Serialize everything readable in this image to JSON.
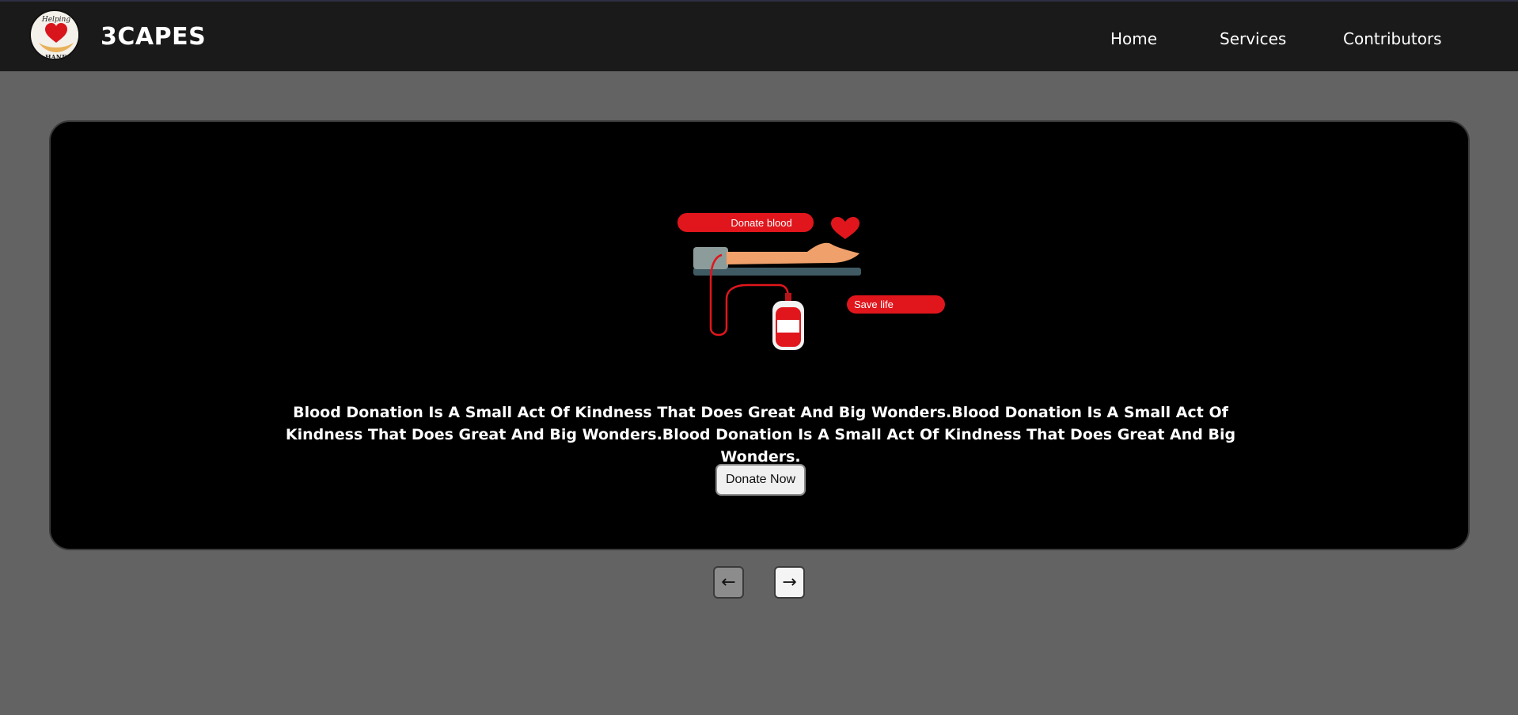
{
  "header": {
    "logo_text_top": "Helping",
    "logo_text_bottom": "HAND",
    "brand": "3CAPES",
    "nav": [
      {
        "label": "Home"
      },
      {
        "label": "Services"
      },
      {
        "label": "Contributors"
      }
    ]
  },
  "slide": {
    "illustration": {
      "donate_label": "Donate blood",
      "save_label": "Save life"
    },
    "message": "Blood Donation Is A Small Act Of Kindness That Does Great And Big Wonders.Blood Donation Is A Small Act Of Kindness That Does Great And Big Wonders.Blood Donation Is A Small Act Of Kindness That Does Great And Big Wonders.",
    "cta_label": "Donate Now"
  },
  "carousel": {
    "prev_label": "←",
    "next_label": "→"
  },
  "colors": {
    "header_bg": "#1a1a1a",
    "page_bg": "#636363",
    "card_bg": "#000000",
    "accent_red": "#e0161c"
  }
}
